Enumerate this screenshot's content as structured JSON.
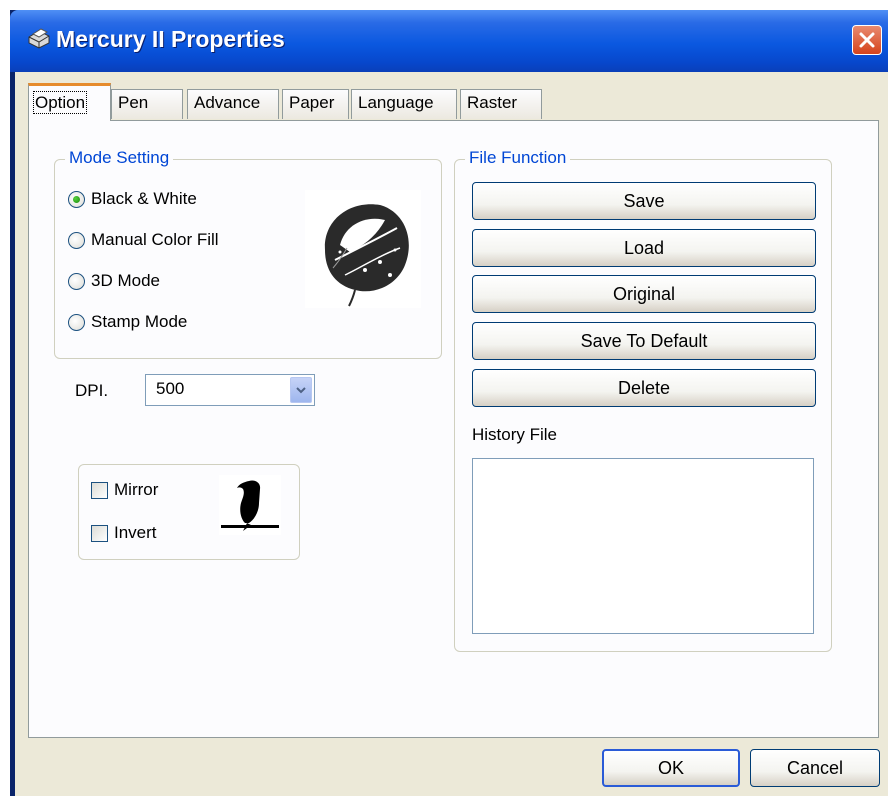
{
  "window": {
    "title": "Mercury II Properties",
    "close_label": "✕"
  },
  "tabs": [
    {
      "label": "Option",
      "active": true
    },
    {
      "label": "Pen"
    },
    {
      "label": "Advance"
    },
    {
      "label": "Paper"
    },
    {
      "label": "Language"
    },
    {
      "label": "Raster"
    }
  ],
  "mode_setting": {
    "legend": "Mode Setting",
    "options": [
      {
        "label": "Black & White",
        "selected": true
      },
      {
        "label": "Manual Color Fill",
        "selected": false
      },
      {
        "label": "3D Mode",
        "selected": false
      },
      {
        "label": "Stamp Mode",
        "selected": false
      }
    ],
    "preview_icon": "leaf-sketch-icon"
  },
  "dpi": {
    "label": "DPI.",
    "value": "500"
  },
  "effects": {
    "mirror_label": "Mirror",
    "invert_label": "Invert",
    "mirror_checked": false,
    "invert_checked": false,
    "preview_icon": "bird-silhouette-icon"
  },
  "file_function": {
    "legend": "File Function",
    "buttons": [
      "Save",
      "Load",
      "Original",
      "Save To Default",
      "Delete"
    ],
    "history_label": "History File",
    "history_items": []
  },
  "footer": {
    "ok_label": "OK",
    "cancel_label": "Cancel"
  },
  "colors": {
    "titlebar": "#0a58e0",
    "accent_tab": "#e68b2c",
    "legend_text": "#0046d5",
    "dialog_bg": "#ece9d8"
  }
}
